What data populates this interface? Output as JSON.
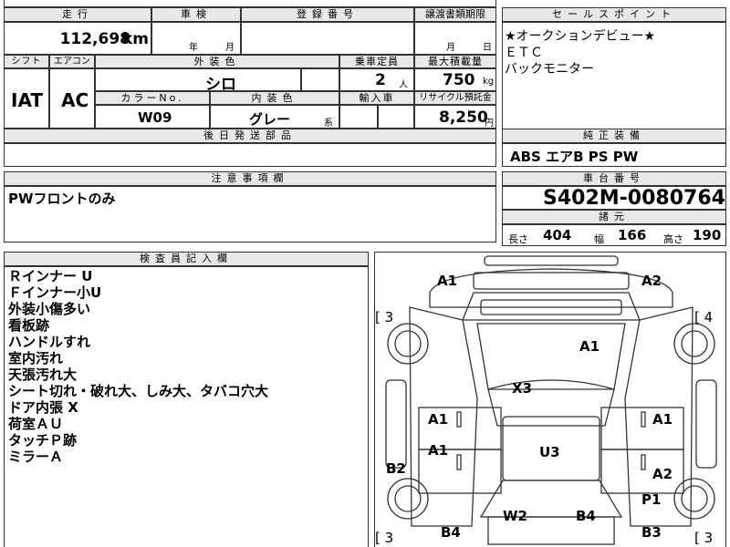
{
  "headers": {
    "mileage": "走行",
    "inspection": "車検",
    "registration": "登録番号",
    "transfer_docs": "譲渡書類期限",
    "sales_point": "セールスポイント",
    "shift": "シフト",
    "aircon": "エアコン",
    "exterior_color": "外装色",
    "capacity": "乗車定員",
    "max_load": "最大積載量",
    "color_no": "カラーNo.",
    "interior_color": "内装色",
    "import": "輸入車",
    "recycle": "リサイクル預託金",
    "later_parts": "後日発送部品",
    "options": "純正装備",
    "notes": "注意事項欄",
    "chassis_no": "車台番号",
    "specs": "諸元",
    "inspector": "検査員記入欄"
  },
  "values": {
    "mileage": "112,698",
    "mileage_unit": "km",
    "inspection_year": "年",
    "inspection_month": "月",
    "transfer_month": "月",
    "transfer_day": "日",
    "shift": "IAT",
    "aircon": "AC",
    "exterior_color": "シロ",
    "capacity": "2",
    "capacity_unit": "人",
    "max_load": "750",
    "max_load_unit": "kg",
    "color_no": "W09",
    "interior_color": "グレー",
    "interior_suffix": "系",
    "recycle": "8,250",
    "recycle_unit": "円",
    "options": "ABS エアB PS PW",
    "chassis_no": "S402M-0080764",
    "length_label": "長さ",
    "length": "404",
    "width_label": "幅",
    "width": "166",
    "height_label": "高さ",
    "height": "190"
  },
  "sales_points": [
    "★オークションデビュー★",
    "ＥＴＣ",
    "バックモニター"
  ],
  "notes_text": "PWフロントのみ",
  "inspector_notes": [
    "Ｒインナー U",
    "Ｆインナー小U",
    "外装小傷多い",
    "看板跡",
    "ハンドルすれ",
    "室内汚れ",
    "天張汚れ大",
    "シート切れ・破れ大、しみ大、タバコ穴大",
    "ドア内張 X",
    "荷室ＡＵ",
    "タッチＰ跡",
    "ミラーＡ"
  ],
  "damage_marks": {
    "front_left": "A1",
    "front_right": "A2",
    "corner_left": "[ 3",
    "corner_right": "[ 4",
    "windshield": "A1",
    "roof_front": "X3",
    "door_fl": "A1",
    "door_fr": "A1",
    "door_rl": "A1",
    "door_rr": "A2",
    "roof_rear": "U3",
    "rear_left_side": "B2",
    "rear_right_side": "P1",
    "tail_left_gate": "W2",
    "tail_right_gate": "B4",
    "bumper_left": "B4",
    "bumper_right": "B3",
    "bottom_left": "[ 3",
    "bottom_right": "[ 3"
  }
}
